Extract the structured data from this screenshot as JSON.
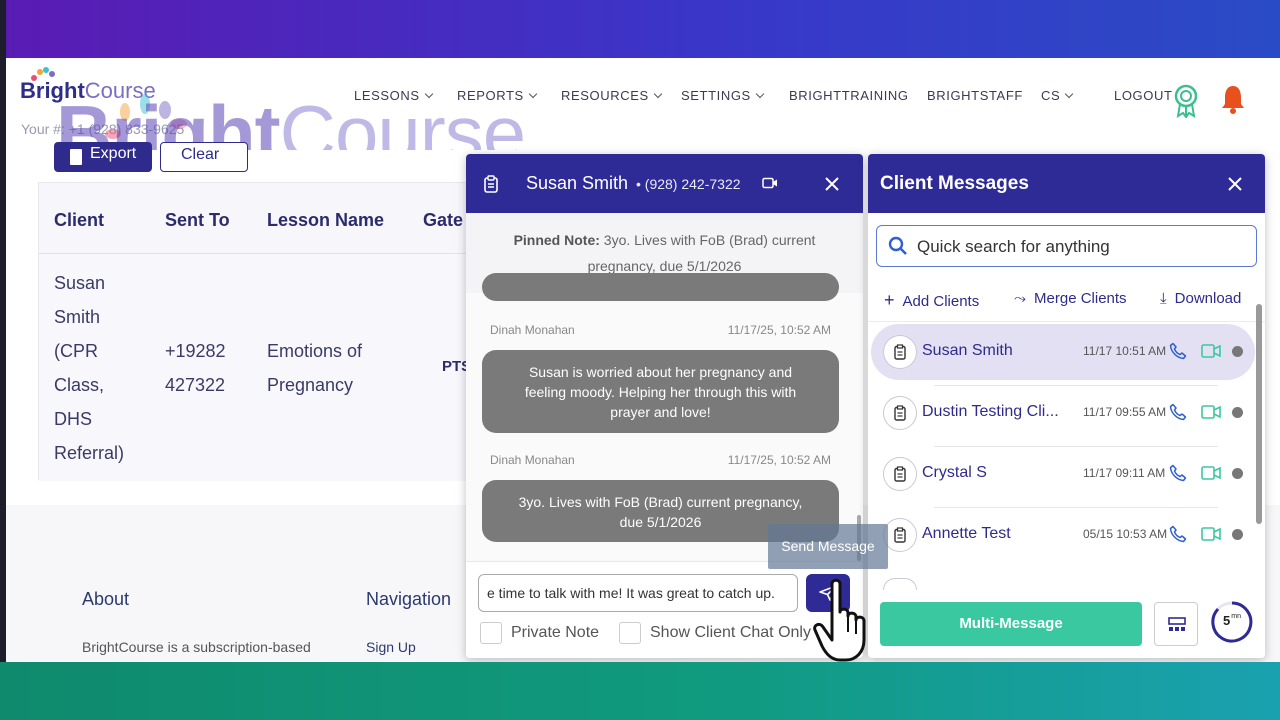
{
  "brand": {
    "name_part1": "Bright",
    "name_part2": "Course",
    "phone_line": "Your #: +1 (928) 833-9625"
  },
  "watermark": {
    "part1": "Bright",
    "part2": "Course"
  },
  "nav": {
    "items": [
      {
        "label": "LESSONS",
        "dropdown": true
      },
      {
        "label": "REPORTS",
        "dropdown": true
      },
      {
        "label": "RESOURCES",
        "dropdown": true
      },
      {
        "label": "SETTINGS",
        "dropdown": true
      },
      {
        "label": "BRIGHTTRAINING",
        "dropdown": false
      },
      {
        "label": "BRIGHTSTAFF",
        "dropdown": false
      },
      {
        "label": "CS",
        "dropdown": true
      },
      {
        "label": "LOGOUT",
        "dropdown": false
      }
    ]
  },
  "toolbar": {
    "export_label": "Export",
    "clear_label": "Clear"
  },
  "table": {
    "headers": [
      "Client",
      "Sent To",
      "Lesson Name",
      "Gate"
    ],
    "row": {
      "client": [
        "Susan",
        "Smith",
        "(CPR",
        "Class,",
        "DHS",
        "Referral)"
      ],
      "sent_to": [
        "+19282",
        "427322"
      ],
      "lesson": [
        "Emotions of",
        "Pregnancy"
      ],
      "gate": "PTS"
    }
  },
  "footer": {
    "about_heading": "About",
    "about_text": "BrightCourse is a subscription-based",
    "nav_heading": "Navigation",
    "nav_link": "Sign Up"
  },
  "chat": {
    "client_name": "Susan Smith",
    "client_phone": "• (928) 242-7322",
    "pinned_label": "Pinned Note:",
    "pinned_text": " 3yo. Lives with FoB (Brad) current pregnancy, due 5/1/2026",
    "messages": [
      {
        "author": "Dinah Monahan",
        "time": "11/17/25, 10:52 AM",
        "text": "Susan is worried about her pregnancy and feeling moody. Helping her through this with prayer and love!"
      },
      {
        "author": "Dinah Monahan",
        "time": "11/17/25, 10:52 AM",
        "text": "3yo. Lives with FoB (Brad) current pregnancy, due 5/1/2026"
      }
    ],
    "input_value": "e time to talk with me! It was great to catch up.",
    "private_note_label": "Private Note",
    "show_client_label": "Show Client Chat Only",
    "send_tooltip": "Send Message"
  },
  "client_messages": {
    "title": "Client Messages",
    "search_placeholder": "Quick search for anything",
    "actions": {
      "add": "Add Clients",
      "merge": "Merge Clients",
      "download": "Download"
    },
    "clients": [
      {
        "name": "Susan Smith",
        "time": "11/17 10:51 AM",
        "selected": true
      },
      {
        "name": "Dustin Testing Cli...",
        "time": "11/17 09:55 AM",
        "selected": false
      },
      {
        "name": "Crystal S",
        "time": "11/17 09:11 AM",
        "selected": false
      },
      {
        "name": "Annette Test",
        "time": "05/15 10:53 AM",
        "selected": false
      }
    ],
    "multi_message_label": "Multi-Message",
    "timer_value": "5",
    "timer_unit": "mn"
  },
  "colors": {
    "brand_purple": "#2f2b96",
    "accent_green": "#3ac8a0",
    "bell_orange": "#e8501e",
    "award_green": "#3bbf8e"
  }
}
